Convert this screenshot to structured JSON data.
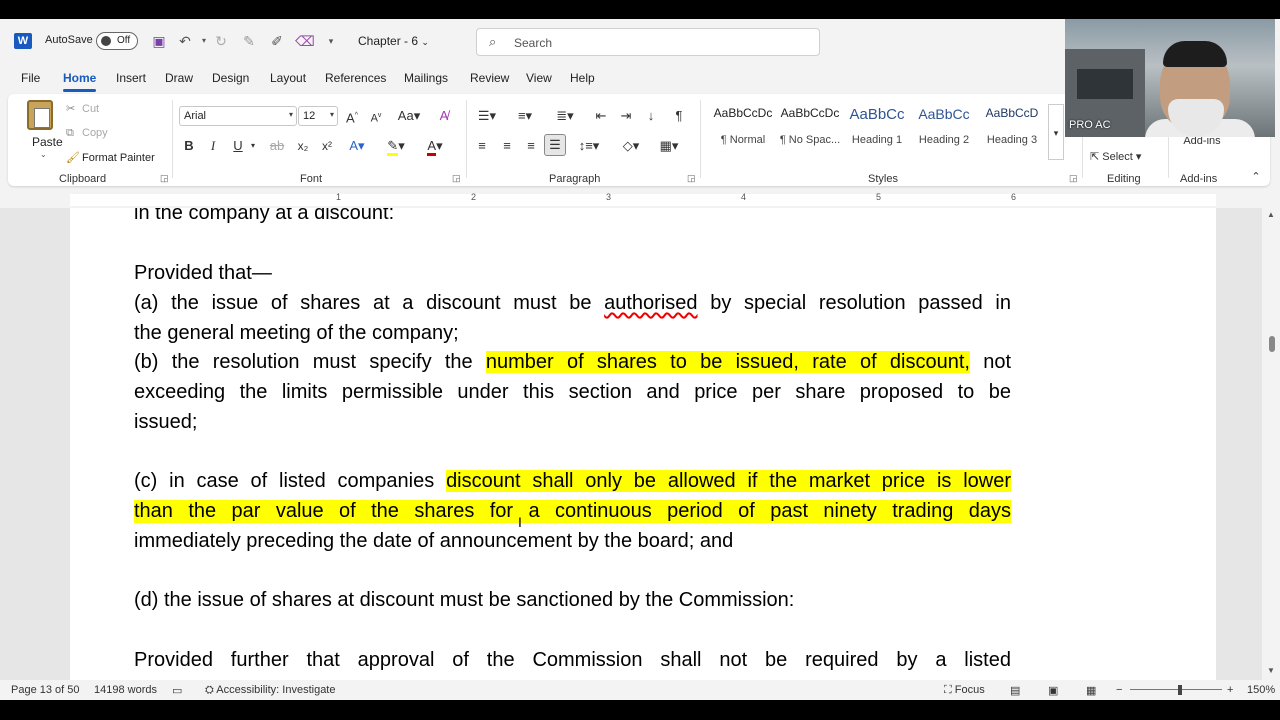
{
  "titlebar": {
    "app_icon": "word-logo-icon",
    "autosave_label": "AutoSave",
    "autosave_state": "Off",
    "doc_name": "Chapter - 6",
    "search_placeholder": "Search"
  },
  "webcam": {
    "label": "PRO AC"
  },
  "tabs": [
    "File",
    "Home",
    "Insert",
    "Draw",
    "Design",
    "Layout",
    "References",
    "Mailings",
    "Review",
    "View",
    "Help"
  ],
  "active_tab": "Home",
  "ribbon": {
    "clipboard": {
      "label": "Clipboard",
      "paste": "Paste",
      "cut": "Cut",
      "copy": "Copy",
      "format_painter": "Format Painter"
    },
    "font": {
      "label": "Font",
      "font_name": "Arial",
      "font_size": "12",
      "bold": "B",
      "italic": "I",
      "underline": "U",
      "subscript": "x₂",
      "superscript": "x²",
      "case": "Aa"
    },
    "paragraph": {
      "label": "Paragraph",
      "pilcrow": "¶"
    },
    "styles": {
      "label": "Styles",
      "items": [
        {
          "sample": "AaBbCcDc",
          "name": "¶ Normal"
        },
        {
          "sample": "AaBbCcDc",
          "name": "¶ No Spac..."
        },
        {
          "sample": "AaBbCc",
          "name": "Heading 1"
        },
        {
          "sample": "AaBbCc",
          "name": "Heading 2"
        },
        {
          "sample": "AaBbCcD",
          "name": "Heading 3"
        }
      ]
    },
    "editing": {
      "label": "Editing",
      "select": "Select"
    },
    "addins": {
      "label": "Add-ins",
      "button": "Add-ins"
    }
  },
  "ruler": {
    "numbers": [
      "1",
      "2",
      "3",
      "4",
      "5",
      "6"
    ]
  },
  "document": {
    "line0": "in the company at a discount:",
    "line1": "Provided that—",
    "para_a_1_pre": "(a) the issue of shares at a discount must be ",
    "para_a_1_sq": "authorised",
    "para_a_1_post": " by special resolution passed in",
    "para_a_2": "the general meeting of the company;",
    "para_b_1_pre": "(b) the resolution must specify the ",
    "para_b_1_hl": "number of shares to be issued, rate of discount,",
    "para_b_1_post": " not",
    "para_b_2": "exceeding the limits permissible under this section and price per share proposed to be",
    "para_b_3": "issued;",
    "para_c_1_pre": "(c) in case of listed companies ",
    "para_c_1_hl": "discount shall only be allowed if the market price is lower",
    "para_c_2_hl": "than the par value of the shares for a continuous period of past ninety trading days",
    "para_c_3": "immediately preceding the date of announcement by the board; and",
    "para_d": "(d) the issue of shares at discount must be sanctioned by the Commission:",
    "para_e": "Provided further that approval of the Commission shall not be required by a listed"
  },
  "statusbar": {
    "page": "Page 13 of 50",
    "words": "14198 words",
    "accessibility": "Accessibility: Investigate",
    "focus": "Focus",
    "zoom": "150%"
  },
  "colors": {
    "accent": "#185abd",
    "highlight": "#ffff00",
    "heading": "#2f5496"
  }
}
